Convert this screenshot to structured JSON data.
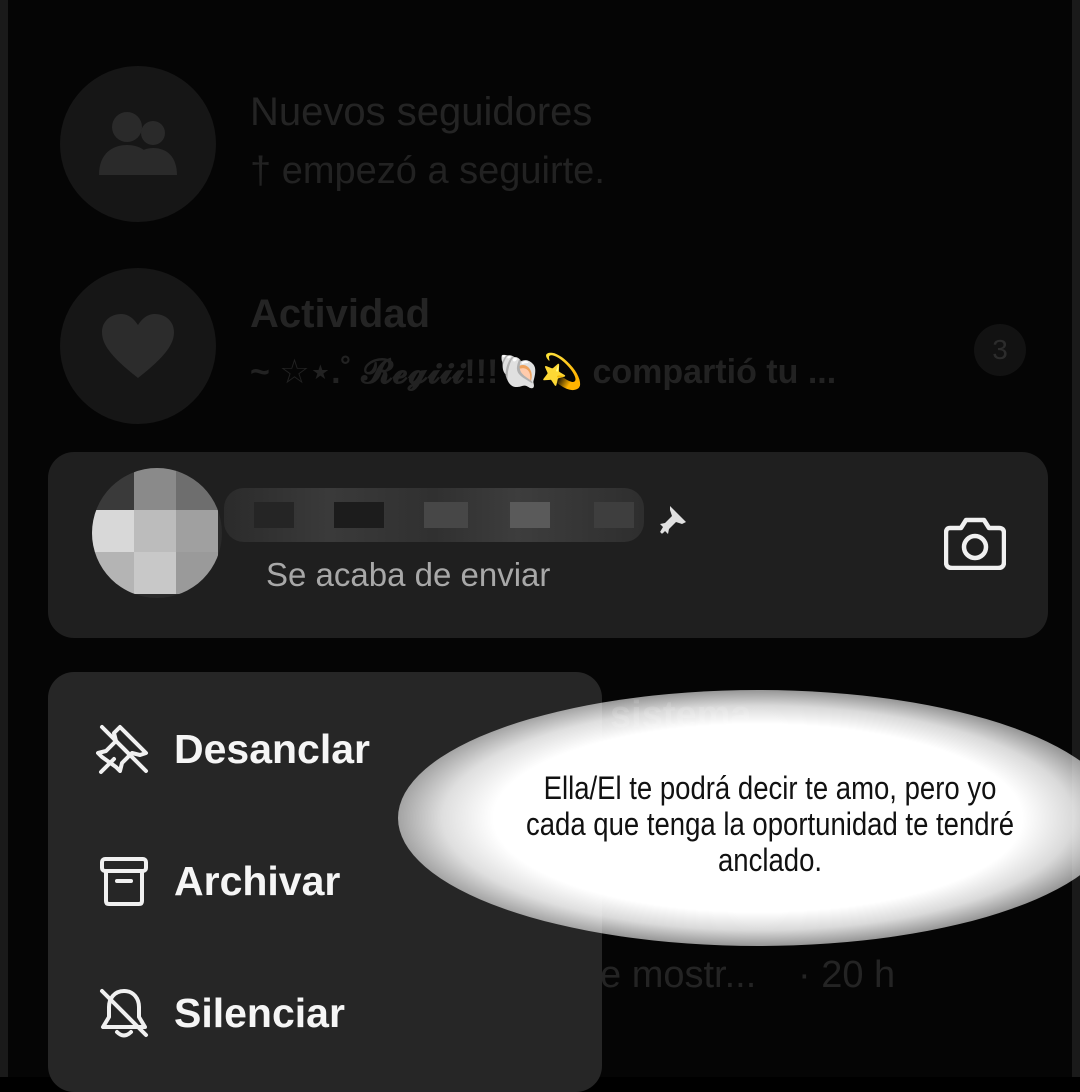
{
  "background_rows": [
    {
      "avatar_icon": "people-icon",
      "title": "Nuevos seguidores",
      "subtitle": "† empezó a seguirte."
    },
    {
      "avatar_icon": "heart-icon",
      "title": "Actividad",
      "subtitle": "~ ☆⋆.˚ 𝓡𝓮𝓰𝓲𝓲𝓲!!!🐚💫 compartió tu ...",
      "badge_count": "3"
    }
  ],
  "background_fragments": {
    "row3_title_fragment": "sistema",
    "row3_subtitle_fragment": "e mostr...",
    "row3_time": "· 20 h"
  },
  "pinned_chat": {
    "status": "Se acaba de enviar",
    "pin_icon": "pin-icon",
    "camera_icon": "camera-icon"
  },
  "context_menu": {
    "items": [
      {
        "label": "Desanclar",
        "icon": "unpin-icon"
      },
      {
        "label": "Archivar",
        "icon": "archive-icon"
      },
      {
        "label": "Silenciar",
        "icon": "bell-off-icon"
      }
    ]
  },
  "overlay_caption": "Ella/El te podrá decir te amo, pero yo cada que tenga la oportunidad te tendré anclado."
}
